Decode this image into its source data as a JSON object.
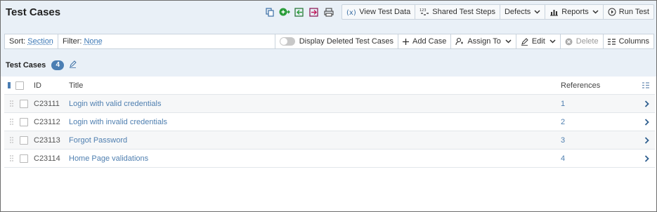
{
  "page": {
    "title": "Test Cases"
  },
  "header": {
    "icons": [
      "copy-icon",
      "add-circle-icon",
      "import-icon",
      "export-icon",
      "print-icon"
    ],
    "view_test_data": "View Test Data",
    "shared_test_steps": "Shared Test Steps",
    "defects": "Defects",
    "reports": "Reports",
    "run_test": "Run Test"
  },
  "filter_bar": {
    "sort_label": "Sort:",
    "sort_value": "Section",
    "filter_label": "Filter:",
    "filter_value": "None",
    "display_deleted": "Display Deleted Test Cases",
    "add_case": "Add Case",
    "assign_to": "Assign To",
    "edit": "Edit",
    "delete": "Delete",
    "columns": "Columns"
  },
  "section": {
    "title": "Test Cases",
    "count": "4"
  },
  "table": {
    "headers": {
      "id": "ID",
      "title": "Title",
      "references": "References"
    },
    "rows": [
      {
        "id": "C23111",
        "title": "Login with valid credentials",
        "references": "1"
      },
      {
        "id": "C23112",
        "title": "Login with invalid credentials",
        "references": "2"
      },
      {
        "id": "C23113",
        "title": "Forgot Password",
        "references": "3"
      },
      {
        "id": "C23114",
        "title": "Home Page validations",
        "references": "4"
      }
    ]
  },
  "colors": {
    "accent": "#4b7eb3",
    "link": "#4f7fb0",
    "header_bg": "#e9f0f7",
    "green": "#2a9d3a",
    "pink": "#c2185b"
  }
}
